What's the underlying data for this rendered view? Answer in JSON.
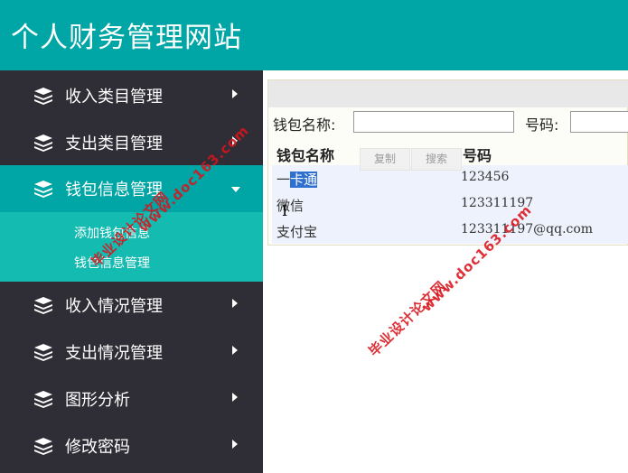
{
  "header": {
    "title": "个人财务管理网站"
  },
  "sidebar": {
    "items": [
      {
        "label": "收入类目管理"
      },
      {
        "label": "支出类目管理"
      },
      {
        "label": "钱包信息管理"
      },
      {
        "label": "收入情况管理"
      },
      {
        "label": "支出情况管理"
      },
      {
        "label": "图形分析"
      },
      {
        "label": "修改密码"
      }
    ],
    "submenu": [
      {
        "label": "添加钱包信息"
      },
      {
        "label": "钱包信息管理"
      }
    ]
  },
  "search": {
    "wallet_name_label": "钱包名称:",
    "wallet_name_value": "",
    "number_label": "号码:",
    "number_value": ""
  },
  "buttons": {
    "copy": "复制",
    "search": "搜索"
  },
  "table": {
    "headers": [
      "钱包名称",
      "号码"
    ],
    "rows": [
      {
        "name_prefix": "一",
        "name_selected": "卡通",
        "number": "123456"
      },
      {
        "name": "微信",
        "number": "123311197"
      },
      {
        "name": "支付宝",
        "number": "123311197@qq.com"
      }
    ]
  },
  "watermarks": [
    "毕业设计论文网",
    "www.doc163.com"
  ],
  "colors": {
    "header": "#00a5a5",
    "sidebar": "#2f2e36",
    "active": "#00a5a5",
    "submenu": "#14bbb1",
    "watermark": "#d9141c"
  }
}
